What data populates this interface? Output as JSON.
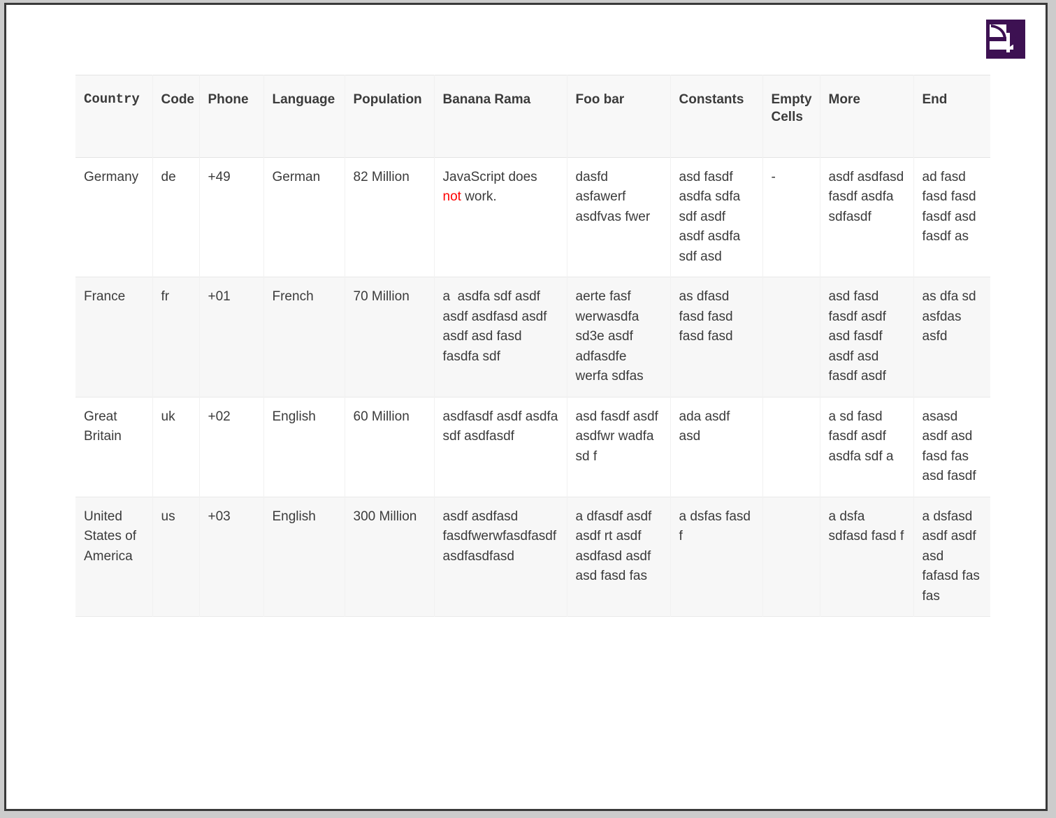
{
  "logo": {
    "name": "wikipedia-style-purple-square-logo",
    "background_color": "#3d1152",
    "foreground_color": "#ffffff"
  },
  "table": {
    "headers": [
      {
        "label": "Country",
        "style": "mono"
      },
      {
        "label": "Code",
        "style": "red"
      },
      {
        "label": "Phone",
        "style": "red"
      },
      {
        "label": "Language",
        "style": "normal"
      },
      {
        "label": "Population",
        "style": "normal"
      },
      {
        "label": "Banana Rama",
        "style": "normal"
      },
      {
        "label": "Foo bar",
        "style": "normal"
      },
      {
        "label": "Constants",
        "style": "normal"
      },
      {
        "label": "Empty Cells",
        "style": "normal"
      },
      {
        "label": "More",
        "style": "normal"
      },
      {
        "label": "End",
        "style": "normal"
      }
    ],
    "rows": [
      {
        "country": "Germany",
        "code": "de",
        "phone": "+49",
        "language": "German",
        "population": "82 Million",
        "banana_rama_prefix": "JavaScript does ",
        "banana_rama_red": "not",
        "banana_rama_suffix": " work.",
        "foo_bar": "dasfd asfawerf asdfvas fwer",
        "constants": "asd fasdf asdfa sdfa sdf asdf asdf asdfa sdf asd",
        "empty_cells": "-",
        "more": "asdf asdfasd fasdf asdfa sdfasdf",
        "end": "ad fasd fasd fasd fasdf asd fasdf as"
      },
      {
        "country": "France",
        "code": "fr",
        "phone": "+01",
        "language": "French",
        "population": "70 Million",
        "banana_rama": "a  asdfa sdf asdf asdf asdfasd asdf asdf asd fasd fasdfa sdf",
        "foo_bar": "aerte fasf werwasdfa sd3e asdf adfasdfe werfa sdfas",
        "constants": "as dfasd fasd fasd fasd fasd",
        "empty_cells": "",
        "more": "asd fasd fasdf asdf asd fasdf asdf asd fasdf asdf",
        "end": "as dfa sd asfdas asfd"
      },
      {
        "country": "Great Britain",
        "code": "uk",
        "phone": "+02",
        "language": "English",
        "population": "60 Million",
        "banana_rama": "asdfasdf asdf asdfa sdf asdfasdf",
        "foo_bar": "asd fasdf asdf asdfwr wadfa sd f",
        "constants": "ada asdf asd",
        "empty_cells": "",
        "more": "a sd fasd fasdf asdf asdfa sdf a",
        "end": "asasd asdf asd fasd fas asd fasdf"
      },
      {
        "country": "United States of America",
        "code": "us",
        "phone": "+03",
        "language": "English",
        "population": "300 Million",
        "banana_rama": "asdf asdfasd fasdfwerwfasdfasdf asdfasdfasd",
        "foo_bar": "a dfasdf asdf asdf rt asdf asdfasd asdf asd fasd fas",
        "constants": "a dsfas fasd f",
        "empty_cells": "",
        "more": "a dsfa sdfasd fasd f",
        "end": "a dsfasd asdf asdf asd fafasd fas fas"
      }
    ]
  }
}
